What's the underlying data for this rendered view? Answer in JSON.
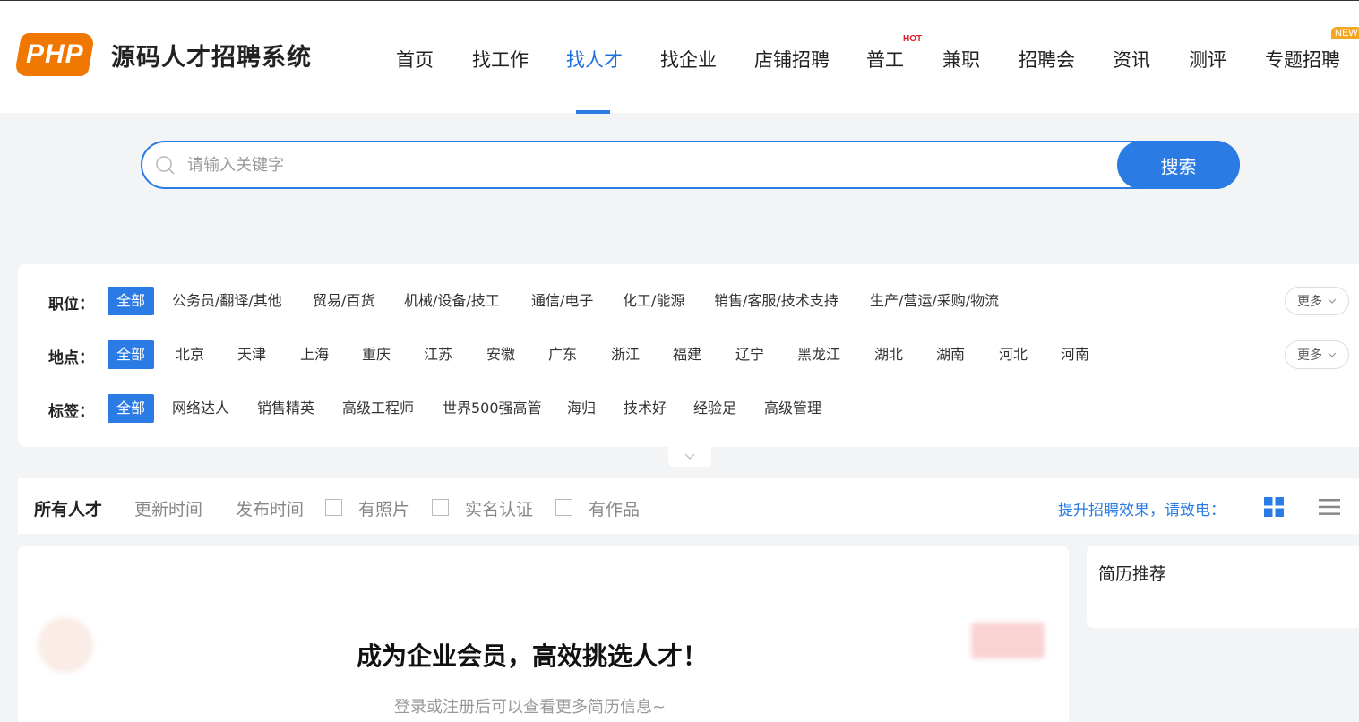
{
  "header": {
    "logo_badge": "PHP",
    "logo_text": "源码人才招聘系统",
    "nav": [
      {
        "label": "首页"
      },
      {
        "label": "找工作"
      },
      {
        "label": "找人才"
      },
      {
        "label": "找企业"
      },
      {
        "label": "店铺招聘"
      },
      {
        "label": "普工"
      },
      {
        "label": "兼职"
      },
      {
        "label": "招聘会"
      },
      {
        "label": "资讯"
      },
      {
        "label": "测评"
      },
      {
        "label": "专题招聘"
      }
    ],
    "active_nav": "找人才",
    "badge_hot": "HOT",
    "badge_new": "NEW",
    "accent_color": "#2b7be5"
  },
  "search": {
    "placeholder": "请输入关键字",
    "button_label": "搜索"
  },
  "filters": {
    "position": {
      "label": "职位：",
      "options": [
        "全部",
        "公务员/翻译/其他",
        "贸易/百货",
        "机械/设备/技工",
        "通信/电子",
        "化工/能源",
        "销售/客服/技术支持",
        "生产/营运/采购/物流"
      ],
      "more": "更多"
    },
    "location": {
      "label": "地点：",
      "options": [
        "全部",
        "北京",
        "天津",
        "上海",
        "重庆",
        "江苏",
        "安徽",
        "广东",
        "浙江",
        "福建",
        "辽宁",
        "黑龙江",
        "湖北",
        "湖南",
        "河北",
        "河南"
      ],
      "more": "更多"
    },
    "tags": {
      "label": "标签：",
      "options": [
        "全部",
        "网络达人",
        "销售精英",
        "高级工程师",
        "世界500强高管",
        "海归",
        "技术好",
        "经验足",
        "高级管理"
      ]
    }
  },
  "sort_bar": {
    "all_talent": "所有人才",
    "update_time": "更新时间",
    "publish_time": "发布时间",
    "has_photo": "有照片",
    "verified": "实名认证",
    "has_works": "有作品",
    "tip": "提升招聘效果，请致电："
  },
  "list": {
    "overlay_title": "成为企业会员，高效挑选人才！",
    "overlay_sub": "登录或注册后可以查看更多简历信息~"
  },
  "sidebar": {
    "title": "简历推荐"
  }
}
